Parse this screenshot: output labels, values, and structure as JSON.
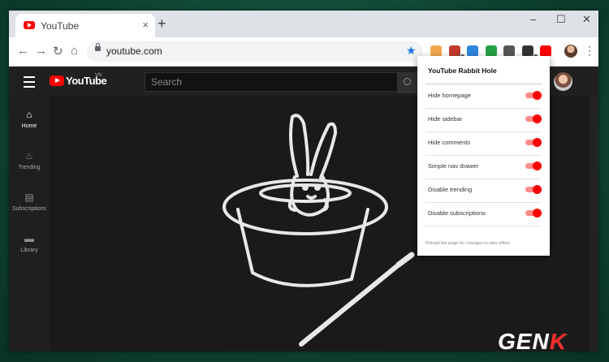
{
  "tab": {
    "title": "YouTube",
    "close": "×"
  },
  "new_tab": "+",
  "window_controls": {
    "minimize": "–",
    "maximize": "☐",
    "close": "✕"
  },
  "toolbar": {
    "back": "←",
    "forward": "→",
    "reload": "↻",
    "home": "⌂",
    "url": "youtube.com",
    "star": "★",
    "menu": "⋮"
  },
  "extensions": [
    {
      "icon": "mail-extension-icon",
      "color": "#f2a84c",
      "badge": ""
    },
    {
      "icon": "dictionary-extension-icon",
      "color": "#c0392b",
      "badge": "1"
    },
    {
      "icon": "j-extension-icon",
      "color": "#2e86de",
      "badge": ""
    },
    {
      "icon": "whatsapp-extension-icon",
      "color": "#25a244",
      "badge": ""
    },
    {
      "icon": "qr-extension-icon",
      "color": "#555555",
      "badge": ""
    },
    {
      "icon": "puzzle-extension-icon",
      "color": "#333333",
      "badge": "1"
    },
    {
      "icon": "youtube-rabbit-hole-icon",
      "color": "#ff0000",
      "badge": ""
    }
  ],
  "youtube": {
    "logo_text": "YouTube",
    "country": "VN",
    "search_placeholder": "Search",
    "guide": [
      {
        "label": "Home",
        "icon": "⌂"
      },
      {
        "label": "Trending",
        "icon": "♨"
      },
      {
        "label": "Subscriptions",
        "icon": "▤"
      },
      {
        "label": "Library",
        "icon": "▬"
      }
    ]
  },
  "popup": {
    "title": "YouTube Rabbit Hole",
    "options": [
      {
        "label": "Hide homepage",
        "enabled": true
      },
      {
        "label": "Hide sidebar",
        "enabled": true
      },
      {
        "label": "Hide comments",
        "enabled": true
      },
      {
        "label": "Simple nav drawer",
        "enabled": true
      },
      {
        "label": "Disable trending",
        "enabled": true
      },
      {
        "label": "Disable subscriptions",
        "enabled": true
      }
    ],
    "note": "Reload the page for changes to take effect."
  },
  "watermark": {
    "text": "GEN",
    "accent": "K"
  },
  "colors": {
    "accent": "#ff0000",
    "dark_bg": "#181818",
    "toggle_track": "#ff8a8a"
  }
}
